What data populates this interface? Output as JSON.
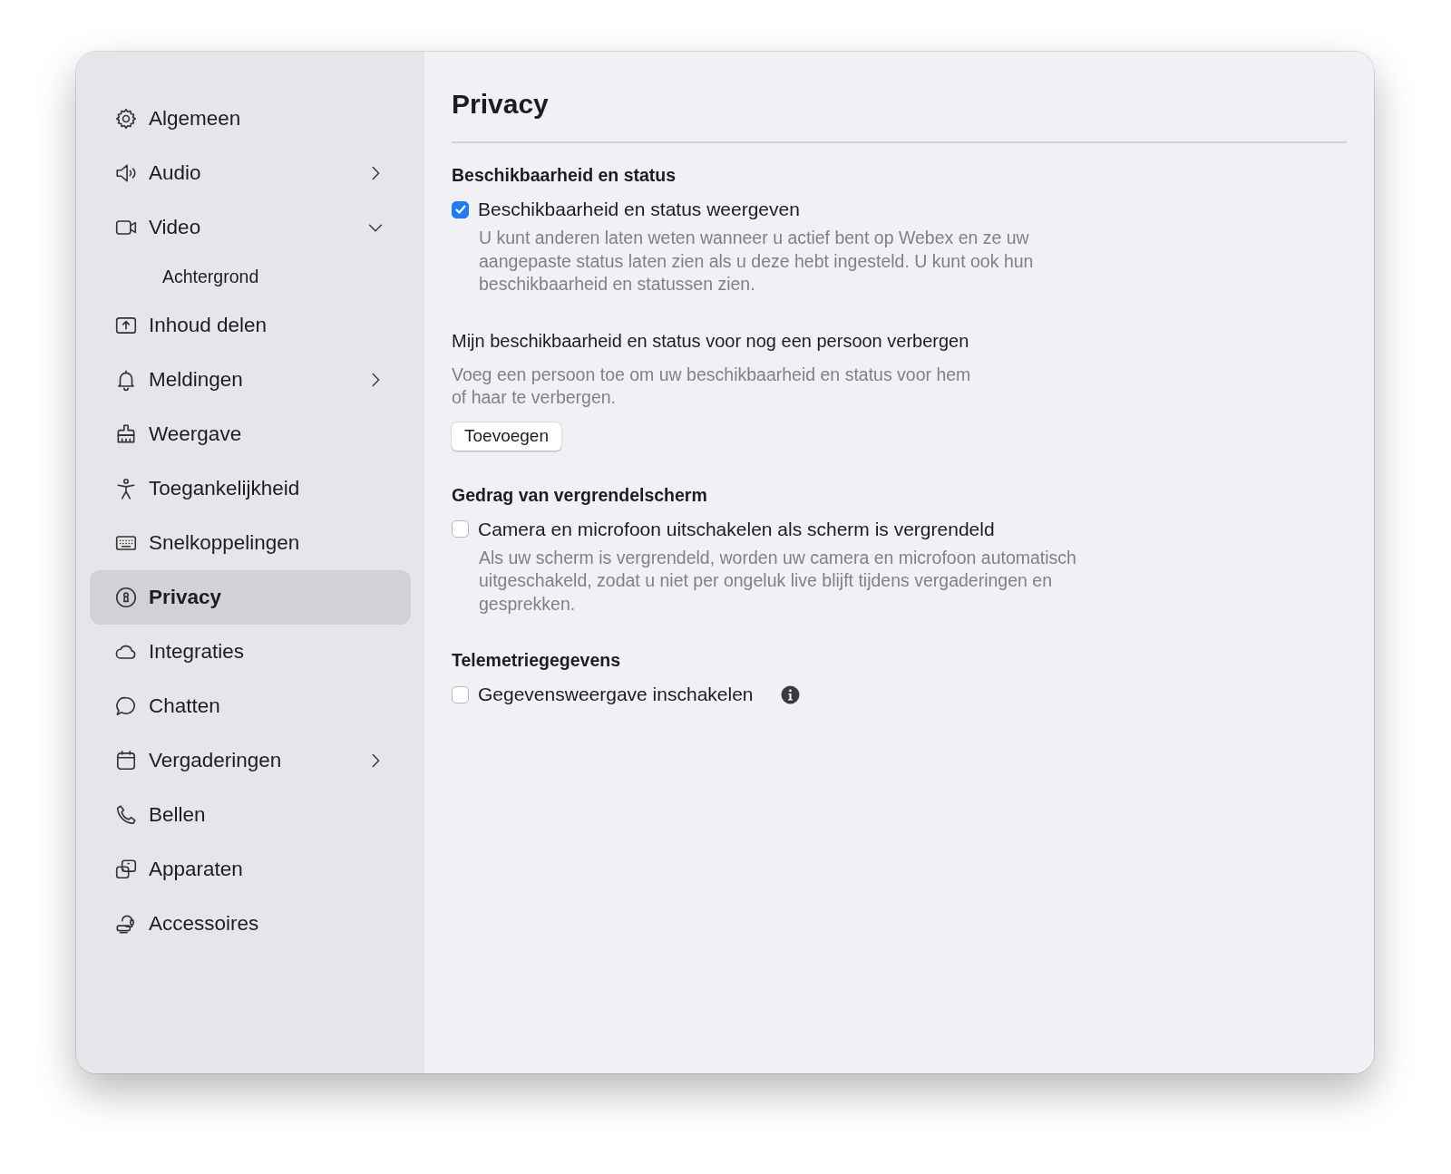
{
  "sidebar": {
    "items": [
      {
        "label": "Algemeen",
        "selected": false
      },
      {
        "label": "Audio",
        "selected": false,
        "expanded": false
      },
      {
        "label": "Video",
        "selected": false,
        "expanded": true,
        "children": [
          {
            "label": "Achtergrond",
            "selected": false
          }
        ]
      },
      {
        "label": "Inhoud delen",
        "selected": false
      },
      {
        "label": "Meldingen",
        "selected": false,
        "expanded": false
      },
      {
        "label": "Weergave",
        "selected": false
      },
      {
        "label": "Toegankelijkheid",
        "selected": false
      },
      {
        "label": "Snelkoppelingen",
        "selected": false
      },
      {
        "label": "Privacy",
        "selected": true
      },
      {
        "label": "Integraties",
        "selected": false
      },
      {
        "label": "Chatten",
        "selected": false
      },
      {
        "label": "Vergaderingen",
        "selected": false,
        "expanded": false
      },
      {
        "label": "Bellen",
        "selected": false
      },
      {
        "label": "Apparaten",
        "selected": false
      },
      {
        "label": "Accessoires",
        "selected": false
      }
    ]
  },
  "page": {
    "title": "Privacy",
    "sections": [
      {
        "heading": "Beschikbaarheid en status",
        "items": [
          {
            "kind": "checkbox",
            "label": "Beschikbaarheid en status weergeven",
            "checked": true,
            "description": "U kunt anderen laten weten wanneer u actief bent op Webex en ze uw aangepaste status laten zien als u deze hebt ingesteld. U kunt ook hun beschikbaarheid en statussen zien."
          },
          {
            "kind": "subsection",
            "title": "Mijn beschikbaarheid en status voor nog een persoon verbergen",
            "description": "Voeg een persoon toe om uw beschikbaarheid en status voor hem of haar te verbergen.",
            "button": "Toevoegen"
          }
        ]
      },
      {
        "heading": "Gedrag van vergrendelscherm",
        "items": [
          {
            "kind": "checkbox",
            "label": "Camera en microfoon uitschakelen als scherm is vergrendeld",
            "checked": false,
            "description": "Als uw scherm is vergrendeld, worden uw camera en microfoon automatisch uitgeschakeld, zodat u niet per ongeluk live blijft tijdens vergaderingen en gesprekken."
          }
        ]
      },
      {
        "heading": "Telemetriegegevens",
        "items": [
          {
            "kind": "checkbox",
            "label": "Gegevensweergave inschakelen",
            "checked": false,
            "info": true
          }
        ]
      }
    ]
  }
}
